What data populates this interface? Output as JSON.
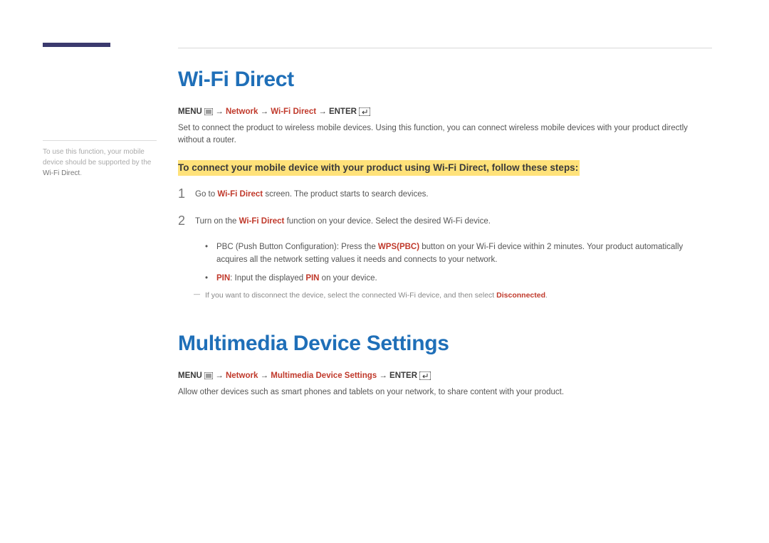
{
  "sidebar": {
    "note_pre": "To use this function, your mobile device should be supported by the ",
    "note_strong": "Wi-Fi Direct",
    "note_post": "."
  },
  "wifi": {
    "heading": "Wi-Fi Direct",
    "nav": {
      "menu": "MENU",
      "arrow": " → ",
      "p1": "Network",
      "p2": "Wi-Fi Direct",
      "enter": "ENTER"
    },
    "desc": "Set to connect the product to wireless mobile devices. Using this function, you can connect wireless mobile devices with your product directly without a router.",
    "highlight": "To connect your mobile device with your product using Wi-Fi Direct, follow these steps:",
    "steps": {
      "s1": {
        "num": "1",
        "pre": "Go to ",
        "strong": "Wi-Fi Direct",
        "post": " screen. The product starts to search devices."
      },
      "s2": {
        "num": "2",
        "pre": "Turn on the ",
        "strong": "Wi-Fi Direct",
        "post": " function on your device. Select the desired Wi-Fi device."
      }
    },
    "bullets": {
      "b1": {
        "pre": "PBC (Push Button Configuration): Press the ",
        "strong": "WPS(PBC)",
        "post": " button on your Wi-Fi device within 2 minutes. Your product automatically acquires all the network setting values it needs and connects to your network."
      },
      "b2": {
        "s1": "PIN",
        "t1": ": Input the displayed ",
        "s2": "PIN",
        "t2": " on your device."
      }
    },
    "footnote": {
      "pre": "If you want to disconnect the device, select the connected Wi-Fi device, and then select ",
      "strong": "Disconnected",
      "post": "."
    }
  },
  "multimedia": {
    "heading": "Multimedia Device Settings",
    "nav": {
      "menu": "MENU",
      "arrow": " → ",
      "p1": "Network",
      "p2": "Multimedia Device Settings",
      "enter": "ENTER"
    },
    "desc": "Allow other devices such as smart phones and tablets on your network, to share content with your product."
  }
}
